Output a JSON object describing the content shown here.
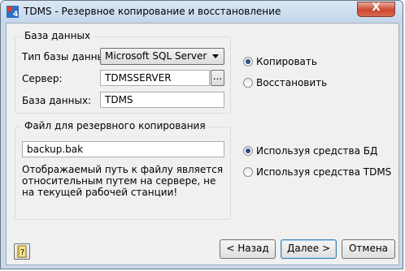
{
  "window": {
    "title": "TDMS - Резервное копирование и восстановление",
    "close_glyph": "X"
  },
  "database_group": {
    "title": "База данных",
    "db_type_label": "Тип базы данных:",
    "db_type_value": "Microsoft SQL Server",
    "server_label": "Сервер:",
    "server_value": "TDMSSERVER",
    "browse_label": "...",
    "database_label": "База данных:",
    "database_value": "TDMS"
  },
  "mode": {
    "copy_label": "Копировать",
    "restore_label": "Восстановить",
    "selected": "copy"
  },
  "backup_group": {
    "title": "Файл для резервного копирования",
    "file_value": "backup.bak",
    "note": "Отображаемый путь к файлу является относительным путем на сервере, не на текущей рабочей станции!"
  },
  "method": {
    "db_tools_label": "Используя средства БД",
    "tdms_tools_label": "Используя средства TDMS",
    "selected": "db_tools"
  },
  "buttons": {
    "back": "< Назад",
    "next": "Далее >",
    "cancel": "Отмена"
  },
  "icons": {
    "app": "tdms-logo-icon",
    "help": "help-book-icon"
  },
  "colors": {
    "selected_radio": "#2a4f88",
    "close_button": "#c9482f"
  }
}
